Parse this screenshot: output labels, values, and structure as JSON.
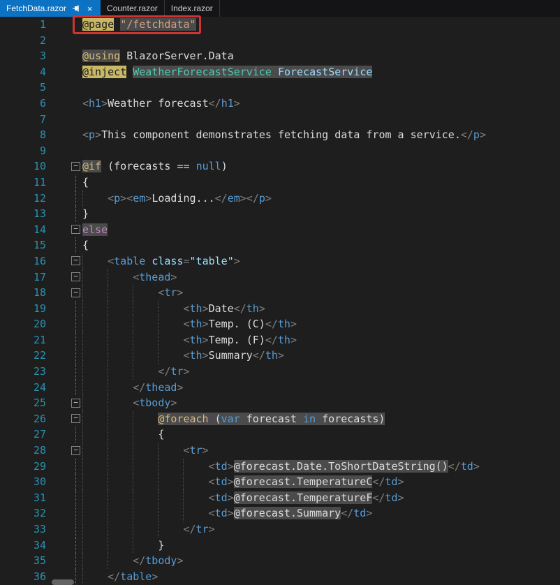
{
  "tabs": [
    {
      "label": "FetchData.razor",
      "active": true
    },
    {
      "label": "Counter.razor",
      "active": false
    },
    {
      "label": "Index.razor",
      "active": false
    }
  ],
  "icons": {
    "close": "×",
    "pin": "pushpin",
    "fold_collapse": "−"
  },
  "colors": {
    "background": "#1E1E1E",
    "active_tab": "#0B72C4",
    "line_number": "#2B91AF",
    "tag_name": "#569CD6",
    "razor_highlight_bg": "#4B4B4B",
    "razor_directive_bg": "#C8B763",
    "annotation_red": "#CE3434"
  },
  "annotation": {
    "target_line": 1,
    "target_text": "@page \"/fetchdata\""
  },
  "editor": {
    "lines": [
      {
        "n": 1,
        "ind": 0,
        "fold": false,
        "gut": false,
        "seg": [
          [
            "@page",
            "dir"
          ],
          [
            " ",
            "plain"
          ],
          [
            "\"/fetchdata\"",
            "strhl"
          ]
        ]
      },
      {
        "n": 2,
        "ind": 0,
        "fold": false,
        "gut": false,
        "seg": []
      },
      {
        "n": 3,
        "ind": 0,
        "fold": false,
        "gut": false,
        "seg": [
          [
            "@using",
            "dir2"
          ],
          [
            " ",
            "plain"
          ],
          [
            "BlazorServer.Data",
            "plain"
          ]
        ]
      },
      {
        "n": 4,
        "ind": 0,
        "fold": false,
        "gut": false,
        "seg": [
          [
            "@inject",
            "dir"
          ],
          [
            " ",
            "plain"
          ],
          [
            "WeatherForecastService",
            "typehl"
          ],
          [
            " ",
            "hl"
          ],
          [
            "ForecastService",
            "identhl"
          ]
        ]
      },
      {
        "n": 5,
        "ind": 0,
        "fold": false,
        "gut": false,
        "seg": []
      },
      {
        "n": 6,
        "ind": 0,
        "fold": false,
        "gut": false,
        "seg": [
          [
            "<",
            "delim"
          ],
          [
            "h1",
            "tag"
          ],
          [
            ">",
            "delim"
          ],
          [
            "Weather forecast",
            "plain"
          ],
          [
            "</",
            "delim"
          ],
          [
            "h1",
            "tag"
          ],
          [
            ">",
            "delim"
          ]
        ]
      },
      {
        "n": 7,
        "ind": 0,
        "fold": false,
        "gut": false,
        "seg": []
      },
      {
        "n": 8,
        "ind": 0,
        "fold": false,
        "gut": false,
        "seg": [
          [
            "<",
            "delim"
          ],
          [
            "p",
            "tag"
          ],
          [
            ">",
            "delim"
          ],
          [
            "This component demonstrates fetching data from a service.",
            "plain"
          ],
          [
            "</",
            "delim"
          ],
          [
            "p",
            "tag"
          ],
          [
            ">",
            "delim"
          ]
        ]
      },
      {
        "n": 9,
        "ind": 0,
        "fold": false,
        "gut": false,
        "seg": []
      },
      {
        "n": 10,
        "ind": 0,
        "fold": true,
        "gut": false,
        "seg": [
          [
            "@if",
            "ctrl"
          ],
          [
            " (forecasts == ",
            "plain"
          ],
          [
            "null",
            "kw"
          ],
          [
            ")",
            "plain"
          ]
        ]
      },
      {
        "n": 11,
        "ind": 0,
        "fold": false,
        "gut": true,
        "seg": [
          [
            "{",
            "plain"
          ]
        ]
      },
      {
        "n": 12,
        "ind": 1,
        "fold": false,
        "gut": true,
        "seg": [
          [
            "<",
            "delim"
          ],
          [
            "p",
            "tag"
          ],
          [
            ">",
            "delim"
          ],
          [
            "<",
            "delim"
          ],
          [
            "em",
            "tag"
          ],
          [
            ">",
            "delim"
          ],
          [
            "Loading...",
            "plain"
          ],
          [
            "</",
            "delim"
          ],
          [
            "em",
            "tag"
          ],
          [
            ">",
            "delim"
          ],
          [
            "</",
            "delim"
          ],
          [
            "p",
            "tag"
          ],
          [
            ">",
            "delim"
          ]
        ]
      },
      {
        "n": 13,
        "ind": 0,
        "fold": false,
        "gut": true,
        "seg": [
          [
            "}",
            "plain"
          ]
        ]
      },
      {
        "n": 14,
        "ind": 0,
        "fold": true,
        "gut": false,
        "seg": [
          [
            "else",
            "elsekw"
          ]
        ]
      },
      {
        "n": 15,
        "ind": 0,
        "fold": false,
        "gut": true,
        "seg": [
          [
            "{",
            "plain"
          ]
        ]
      },
      {
        "n": 16,
        "ind": 1,
        "fold": true,
        "gut": false,
        "seg": [
          [
            "<",
            "delim"
          ],
          [
            "table",
            "tag"
          ],
          [
            " ",
            "plain"
          ],
          [
            "class",
            "attr"
          ],
          [
            "=",
            "delim"
          ],
          [
            "\"table\"",
            "attrval"
          ],
          [
            ">",
            "delim"
          ]
        ]
      },
      {
        "n": 17,
        "ind": 2,
        "fold": true,
        "gut": false,
        "seg": [
          [
            "<",
            "delim"
          ],
          [
            "thead",
            "tag"
          ],
          [
            ">",
            "delim"
          ]
        ]
      },
      {
        "n": 18,
        "ind": 3,
        "fold": true,
        "gut": false,
        "seg": [
          [
            "<",
            "delim"
          ],
          [
            "tr",
            "tag"
          ],
          [
            ">",
            "delim"
          ]
        ]
      },
      {
        "n": 19,
        "ind": 4,
        "fold": false,
        "gut": true,
        "seg": [
          [
            "<",
            "delim"
          ],
          [
            "th",
            "tag"
          ],
          [
            ">",
            "delim"
          ],
          [
            "Date",
            "plain"
          ],
          [
            "</",
            "delim"
          ],
          [
            "th",
            "tag"
          ],
          [
            ">",
            "delim"
          ]
        ]
      },
      {
        "n": 20,
        "ind": 4,
        "fold": false,
        "gut": true,
        "seg": [
          [
            "<",
            "delim"
          ],
          [
            "th",
            "tag"
          ],
          [
            ">",
            "delim"
          ],
          [
            "Temp. (C)",
            "plain"
          ],
          [
            "</",
            "delim"
          ],
          [
            "th",
            "tag"
          ],
          [
            ">",
            "delim"
          ]
        ]
      },
      {
        "n": 21,
        "ind": 4,
        "fold": false,
        "gut": true,
        "seg": [
          [
            "<",
            "delim"
          ],
          [
            "th",
            "tag"
          ],
          [
            ">",
            "delim"
          ],
          [
            "Temp. (F)",
            "plain"
          ],
          [
            "</",
            "delim"
          ],
          [
            "th",
            "tag"
          ],
          [
            ">",
            "delim"
          ]
        ]
      },
      {
        "n": 22,
        "ind": 4,
        "fold": false,
        "gut": true,
        "seg": [
          [
            "<",
            "delim"
          ],
          [
            "th",
            "tag"
          ],
          [
            ">",
            "delim"
          ],
          [
            "Summary",
            "plain"
          ],
          [
            "</",
            "delim"
          ],
          [
            "th",
            "tag"
          ],
          [
            ">",
            "delim"
          ]
        ]
      },
      {
        "n": 23,
        "ind": 3,
        "fold": false,
        "gut": true,
        "seg": [
          [
            "</",
            "delim"
          ],
          [
            "tr",
            "tag"
          ],
          [
            ">",
            "delim"
          ]
        ]
      },
      {
        "n": 24,
        "ind": 2,
        "fold": false,
        "gut": true,
        "seg": [
          [
            "</",
            "delim"
          ],
          [
            "thead",
            "tag"
          ],
          [
            ">",
            "delim"
          ]
        ]
      },
      {
        "n": 25,
        "ind": 2,
        "fold": true,
        "gut": false,
        "seg": [
          [
            "<",
            "delim"
          ],
          [
            "tbody",
            "tag"
          ],
          [
            ">",
            "delim"
          ]
        ]
      },
      {
        "n": 26,
        "ind": 3,
        "fold": true,
        "gut": false,
        "seg": [
          [
            "@foreach",
            "ctrl"
          ],
          [
            " (",
            "hl"
          ],
          [
            "var",
            "kwhl"
          ],
          [
            " forecast ",
            "hl"
          ],
          [
            "in",
            "kwhl"
          ],
          [
            " forecasts)",
            "hl"
          ]
        ]
      },
      {
        "n": 27,
        "ind": 3,
        "fold": false,
        "gut": true,
        "seg": [
          [
            "{",
            "plain"
          ]
        ]
      },
      {
        "n": 28,
        "ind": 4,
        "fold": true,
        "gut": false,
        "seg": [
          [
            "<",
            "delim"
          ],
          [
            "tr",
            "tag"
          ],
          [
            ">",
            "delim"
          ]
        ]
      },
      {
        "n": 29,
        "ind": 5,
        "fold": false,
        "gut": true,
        "seg": [
          [
            "<",
            "delim"
          ],
          [
            "td",
            "tag"
          ],
          [
            ">",
            "delim"
          ],
          [
            "@forecast.Date.ToShortDateString()",
            "hl"
          ],
          [
            "</",
            "delim"
          ],
          [
            "td",
            "tag"
          ],
          [
            ">",
            "delim"
          ]
        ]
      },
      {
        "n": 30,
        "ind": 5,
        "fold": false,
        "gut": true,
        "seg": [
          [
            "<",
            "delim"
          ],
          [
            "td",
            "tag"
          ],
          [
            ">",
            "delim"
          ],
          [
            "@forecast.TemperatureC",
            "hl"
          ],
          [
            "</",
            "delim"
          ],
          [
            "td",
            "tag"
          ],
          [
            ">",
            "delim"
          ]
        ]
      },
      {
        "n": 31,
        "ind": 5,
        "fold": false,
        "gut": true,
        "seg": [
          [
            "<",
            "delim"
          ],
          [
            "td",
            "tag"
          ],
          [
            ">",
            "delim"
          ],
          [
            "@forecast.TemperatureF",
            "hl"
          ],
          [
            "</",
            "delim"
          ],
          [
            "td",
            "tag"
          ],
          [
            ">",
            "delim"
          ]
        ]
      },
      {
        "n": 32,
        "ind": 5,
        "fold": false,
        "gut": true,
        "seg": [
          [
            "<",
            "delim"
          ],
          [
            "td",
            "tag"
          ],
          [
            ">",
            "delim"
          ],
          [
            "@forecast.Summary",
            "hl"
          ],
          [
            "</",
            "delim"
          ],
          [
            "td",
            "tag"
          ],
          [
            ">",
            "delim"
          ]
        ]
      },
      {
        "n": 33,
        "ind": 4,
        "fold": false,
        "gut": true,
        "seg": [
          [
            "</",
            "delim"
          ],
          [
            "tr",
            "tag"
          ],
          [
            ">",
            "delim"
          ]
        ]
      },
      {
        "n": 34,
        "ind": 3,
        "fold": false,
        "gut": true,
        "seg": [
          [
            "}",
            "plain"
          ]
        ]
      },
      {
        "n": 35,
        "ind": 2,
        "fold": false,
        "gut": true,
        "seg": [
          [
            "</",
            "delim"
          ],
          [
            "tbody",
            "tag"
          ],
          [
            ">",
            "delim"
          ]
        ]
      },
      {
        "n": 36,
        "ind": 1,
        "fold": false,
        "gut": true,
        "seg": [
          [
            "</",
            "delim"
          ],
          [
            "table",
            "tag"
          ],
          [
            ">",
            "delim"
          ]
        ]
      }
    ]
  }
}
